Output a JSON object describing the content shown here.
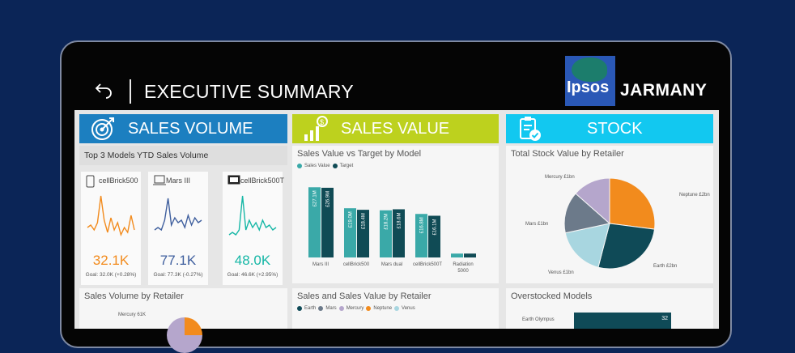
{
  "header": {
    "title": "EXECUTIVE SUMMARY",
    "logo_text": "Ipsos",
    "brand": "JARMANY"
  },
  "sections": [
    {
      "label": "SALES VOLUME",
      "color": "#1c7fc0",
      "icon": "target-icon"
    },
    {
      "label": "SALES VALUE",
      "color": "#bdd11e",
      "icon": "chart-coin-icon"
    },
    {
      "label": "STOCK",
      "color": "#12c8f0",
      "icon": "clipboard-check-icon"
    }
  ],
  "volume": {
    "subheader": "Top 3 Models YTD Sales Volume",
    "kpis": [
      {
        "name": "cellBrick500",
        "value": "32.1K",
        "goal": "Goal: 32.0K (+0.28%)",
        "color": "#f28b1d",
        "icon": "phone-icon",
        "trend": [
          0.35,
          0.4,
          0.3,
          0.45,
          1.0,
          0.5,
          0.25,
          0.55,
          0.3,
          0.45,
          0.2,
          0.35,
          0.25,
          0.6,
          0.3
        ]
      },
      {
        "name": "Mars III",
        "value": "77.1K",
        "goal": "Goal: 77.3K (-0.27%)",
        "color": "#3f5f9e",
        "icon": "laptop-icon",
        "trend": [
          0.3,
          0.35,
          0.3,
          0.5,
          0.95,
          0.4,
          0.55,
          0.45,
          0.5,
          0.35,
          0.6,
          0.4,
          0.55,
          0.45,
          0.5
        ]
      },
      {
        "name": "cellBrick500T",
        "value": "48.0K",
        "goal": "Goal: 46.6K (+2.95%)",
        "color": "#16b7a6",
        "icon": "tablet-icon",
        "trend": [
          0.2,
          0.25,
          0.2,
          0.3,
          1.0,
          0.3,
          0.5,
          0.35,
          0.45,
          0.3,
          0.5,
          0.35,
          0.4,
          0.3,
          0.35
        ]
      }
    ],
    "retailer_title": "Sales Volume by Retailer",
    "retailer_label": "Mercury 61K"
  },
  "value": {
    "title": "Sales Value vs Target by Model",
    "legend": [
      "Sales Value",
      "Target"
    ],
    "legend_colors": [
      "#3aa9a8",
      "#104b55"
    ],
    "retailer_title": "Sales and Sales Value by Retailer",
    "retailer_legend": [
      "Earth",
      "Mars",
      "Mercury",
      "Neptune",
      "Venus"
    ],
    "retailer_colors": [
      "#0f4a57",
      "#6c7a8a",
      "#b5a6cc",
      "#f28b1d",
      "#a8d6e0"
    ]
  },
  "chart_data": {
    "type": "bar",
    "categories": [
      "Mars III",
      "cellBrick500",
      "Mars dual",
      "cellBrick500T",
      "Radiation 5000"
    ],
    "series": [
      {
        "name": "Sales Value",
        "values": [
          27.1,
          19.0,
          18.2,
          16.8,
          1.5
        ],
        "labels": [
          "£27.1M",
          "£19.0M",
          "£18.2M",
          "£16.8M",
          ""
        ]
      },
      {
        "name": "Target",
        "values": [
          26.9,
          18.4,
          18.6,
          16.1,
          1.5
        ],
        "labels": [
          "£26.9M",
          "£18.4M",
          "£18.6M",
          "£16.1M",
          ""
        ]
      }
    ],
    "ylim": [
      0,
      30
    ]
  },
  "stock": {
    "title": "Total Stock Value by Retailer",
    "pie": [
      {
        "label": "Neptune £2bn",
        "value": 2.0,
        "color": "#f28b1d"
      },
      {
        "label": "Earth £2bn",
        "value": 2.0,
        "color": "#0f4a57"
      },
      {
        "label": "Venus £1bn",
        "value": 1.3,
        "color": "#a8d6e0"
      },
      {
        "label": "Mars £1bn",
        "value": 1.1,
        "color": "#6c7a8a"
      },
      {
        "label": "Mercury £1bn",
        "value": 1.0,
        "color": "#b5a6cc"
      }
    ],
    "overstock_title": "Overstocked Models",
    "overstock_label": "Earth Olympus",
    "overstock_value": "32"
  }
}
